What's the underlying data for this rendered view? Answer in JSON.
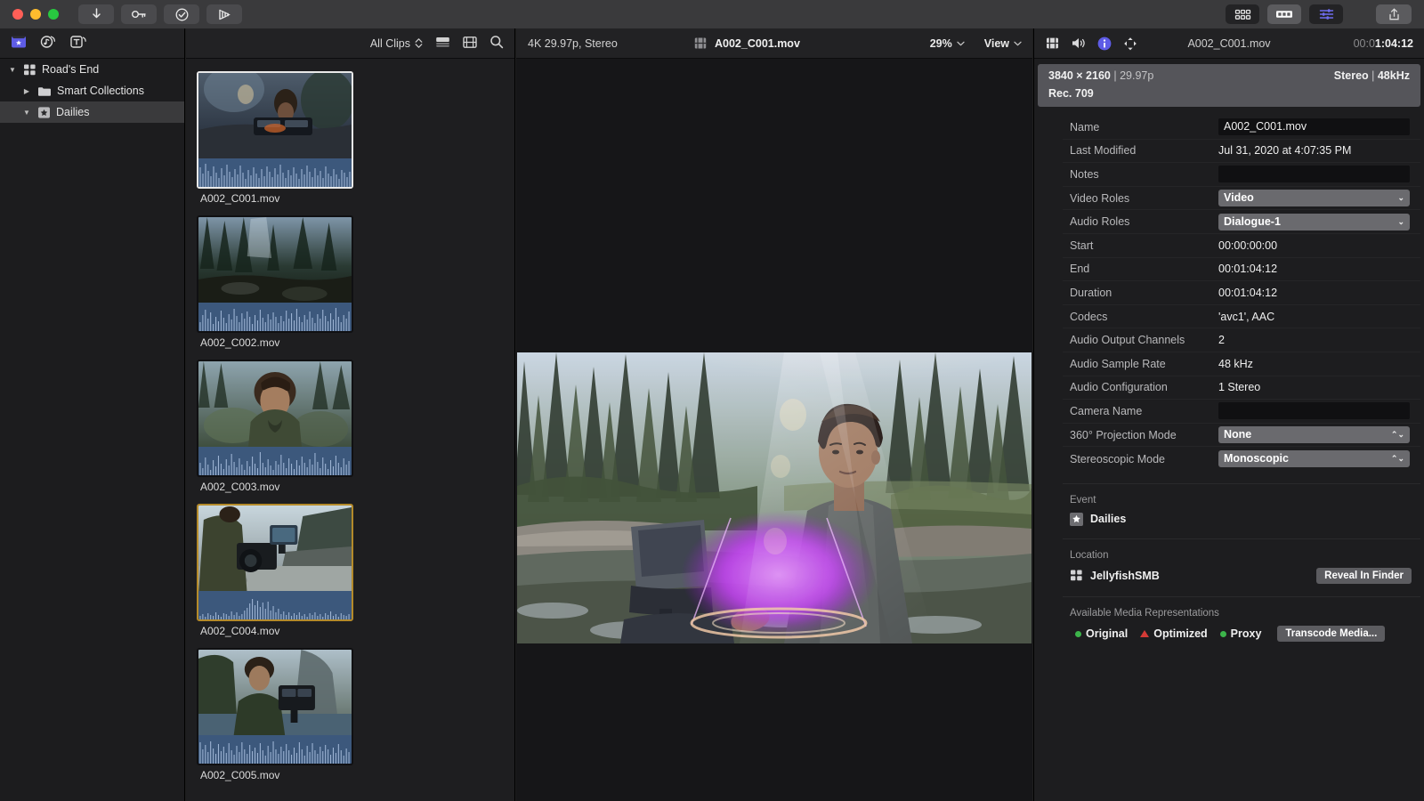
{
  "window": {
    "traffic_lights": [
      "close",
      "minimize",
      "zoom"
    ],
    "toolbar_left": [
      {
        "name": "import-media-button",
        "icon": "download-arrow-icon"
      },
      {
        "name": "keyword-editor-button",
        "icon": "key-icon"
      },
      {
        "name": "analyze-button",
        "icon": "checkmark-circle-icon"
      },
      {
        "name": "audio-enhance-button",
        "icon": "audio-waveform-icon"
      }
    ],
    "toolbar_right": [
      {
        "name": "browser-toggle-button",
        "icon": "grid-6-dots-icon",
        "active": false
      },
      {
        "name": "timeline-toggle-button",
        "icon": "timeline-strip-icon",
        "active": true
      },
      {
        "name": "inspector-toggle-button",
        "icon": "sliders-icon",
        "active": false
      },
      {
        "name": "share-button",
        "icon": "share-upload-icon"
      }
    ],
    "accent_color": "#5e5ce6"
  },
  "sidebar": {
    "toolbar_icons": [
      {
        "name": "libraries-icon",
        "label": "Libraries"
      },
      {
        "name": "photos-audio-icon",
        "label": "Photos and Audio"
      },
      {
        "name": "titles-generators-icon",
        "label": "Titles and Generators"
      }
    ],
    "items": [
      {
        "label": "Road's End",
        "icon": "library-icon",
        "depth": 0,
        "expanded": true,
        "selected": false
      },
      {
        "label": "Smart Collections",
        "icon": "folder-icon",
        "depth": 1,
        "expanded": false,
        "selected": false
      },
      {
        "label": "Dailies",
        "icon": "event-star-icon",
        "depth": 1,
        "expanded": true,
        "selected": true
      }
    ]
  },
  "browser": {
    "filter_label": "All Clips",
    "toolbar_icons": [
      {
        "name": "clip-appearance-icon"
      },
      {
        "name": "filmstrip-view-icon"
      },
      {
        "name": "search-icon"
      }
    ],
    "clips": [
      {
        "label": "A002_C001.mov",
        "state": "selected",
        "scene": "tent-console"
      },
      {
        "label": "A002_C002.mov",
        "state": "normal",
        "scene": "forest-light"
      },
      {
        "label": "A002_C003.mov",
        "state": "normal",
        "scene": "portrait-closeup"
      },
      {
        "label": "A002_C004.mov",
        "state": "favorite",
        "scene": "beach-camera"
      },
      {
        "label": "A002_C005.mov",
        "state": "normal",
        "scene": "river-camera"
      }
    ]
  },
  "viewer": {
    "format": "4K 29.97p, Stereo",
    "clip_icon": "filmstrip-icon",
    "clip_name": "A002_C001.mov",
    "zoom_level": "29%",
    "view_label": "View"
  },
  "inspector": {
    "tabs": [
      {
        "name": "video-inspector-tab",
        "icon": "filmstrip-icon",
        "active": false
      },
      {
        "name": "audio-inspector-tab",
        "icon": "speaker-icon",
        "active": false
      },
      {
        "name": "info-inspector-tab",
        "icon": "info-circle-icon",
        "active": true
      },
      {
        "name": "share-inspector-tab",
        "icon": "anchor-share-icon",
        "active": false
      }
    ],
    "title": "A002_C001.mov",
    "timecode": {
      "dim": "00:0",
      "bright": "1:04:12"
    },
    "summary": {
      "resolution": "3840 × 2160",
      "framerate": "29.97p",
      "audio": "Stereo",
      "sample_rate": "48kHz",
      "colorspace": "Rec. 709"
    },
    "metadata": [
      {
        "label": "Name",
        "value": "A002_C001.mov",
        "kind": "field"
      },
      {
        "label": "Last Modified",
        "value": "Jul 31, 2020 at 4:07:35 PM",
        "kind": "text"
      },
      {
        "label": "Notes",
        "value": "",
        "kind": "field"
      },
      {
        "label": "Video Roles",
        "value": "Video",
        "kind": "popup"
      },
      {
        "label": "Audio Roles",
        "value": "Dialogue-1",
        "kind": "popup"
      },
      {
        "label": "Start",
        "value": "00:00:00:00",
        "kind": "text"
      },
      {
        "label": "End",
        "value": "00:01:04:12",
        "kind": "text"
      },
      {
        "label": "Duration",
        "value": "00:01:04:12",
        "kind": "text"
      },
      {
        "label": "Codecs",
        "value": "'avc1', AAC",
        "kind": "text"
      },
      {
        "label": "Audio Output Channels",
        "value": "2",
        "kind": "text"
      },
      {
        "label": "Audio Sample Rate",
        "value": "48 kHz",
        "kind": "text"
      },
      {
        "label": "Audio Configuration",
        "value": "1 Stereo",
        "kind": "text"
      },
      {
        "label": "Camera Name",
        "value": "",
        "kind": "field"
      },
      {
        "label": "360° Projection Mode",
        "value": "None",
        "kind": "stepper"
      },
      {
        "label": "Stereoscopic Mode",
        "value": "Monoscopic",
        "kind": "stepper"
      }
    ],
    "event_section": {
      "title": "Event",
      "name": "Dailies",
      "icon": "event-star-icon"
    },
    "location_section": {
      "title": "Location",
      "name": "JellyfishSMB",
      "icon": "library-icon",
      "button": "Reveal In Finder"
    },
    "media_section": {
      "title": "Available Media Representations",
      "reps": [
        {
          "label": "Original",
          "marker": "dot",
          "color": "#3cb44a"
        },
        {
          "label": "Optimized",
          "marker": "triangle",
          "color": "#d43a36"
        },
        {
          "label": "Proxy",
          "marker": "dot",
          "color": "#3cb44a"
        }
      ],
      "button": "Transcode Media..."
    }
  }
}
